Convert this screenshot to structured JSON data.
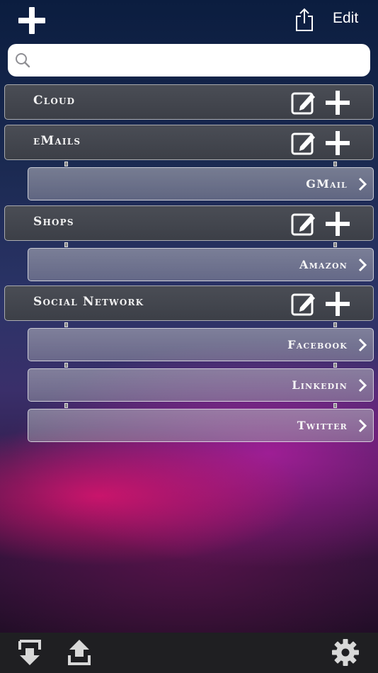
{
  "topbar": {
    "edit_label": "Edit",
    "add_icon": "plus-icon",
    "share_icon": "share-icon"
  },
  "search": {
    "value": "",
    "placeholder": "",
    "icon": "search-icon"
  },
  "groups": [
    {
      "label": "Cloud",
      "items": []
    },
    {
      "label": "eMails",
      "items": [
        {
          "label": "GMail"
        }
      ]
    },
    {
      "label": "Shops",
      "items": [
        {
          "label": "Amazon"
        }
      ]
    },
    {
      "label": "Social Network",
      "items": [
        {
          "label": "Facebook"
        },
        {
          "label": "Linkedin"
        },
        {
          "label": "Twitter"
        }
      ]
    }
  ],
  "bottombar": {
    "import_icon": "import-icon",
    "export_icon": "export-icon",
    "settings_icon": "gear-icon"
  },
  "colors": {
    "group_bg": "#43464e",
    "item_bg": "#a2a2b0",
    "bottombar_bg": "#1f1f22",
    "accent_pink": "#dc146e"
  }
}
